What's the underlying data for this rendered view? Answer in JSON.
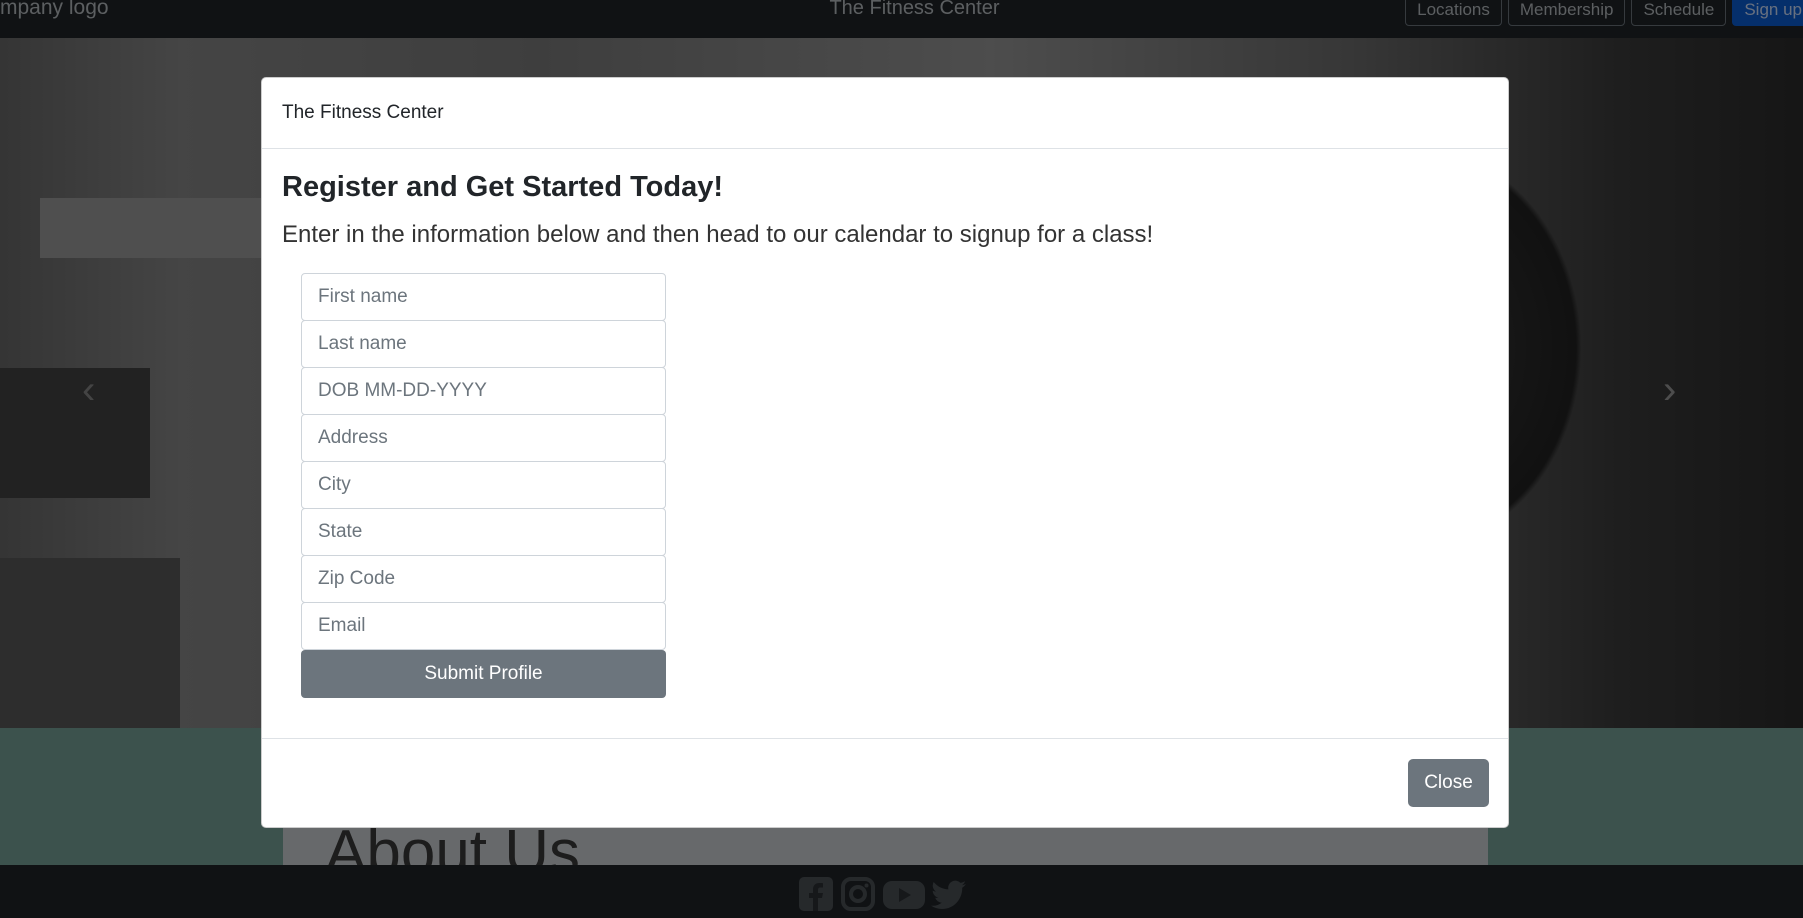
{
  "navbar": {
    "brand": "mpany logo",
    "title": "The Fitness Center",
    "links": [
      "Locations",
      "Membership",
      "Schedule",
      "Sign up"
    ]
  },
  "hero": {
    "prev_icon": "chevron-left-icon",
    "next_icon": "chevron-right-icon"
  },
  "about": {
    "title": "About Us"
  },
  "footer": {
    "social_icons": [
      "facebook-icon",
      "instagram-icon",
      "youtube-icon",
      "twitter-icon"
    ]
  },
  "modal": {
    "title": "The Fitness Center",
    "heading": "Register and Get Started Today!",
    "lead": "Enter in the information below and then head to our calendar to signup for a class!",
    "fields": {
      "first_name": "First name",
      "last_name": "Last name",
      "dob": "DOB MM-DD-YYYY",
      "address": "Address",
      "city": "City",
      "state": "State",
      "zip": "Zip Code",
      "email": "Email"
    },
    "submit_label": "Submit Profile",
    "close_label": "Close"
  },
  "colors": {
    "navbar": "#212529",
    "teal": "#79a49a",
    "button": "#6c757d",
    "primary": "#0b5ed7"
  }
}
